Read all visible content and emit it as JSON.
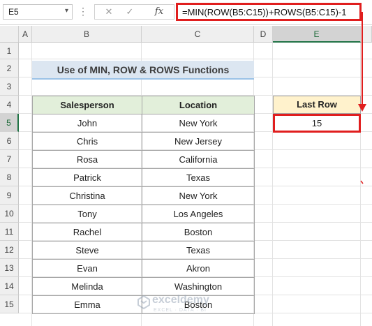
{
  "name_box": {
    "value": "E5",
    "icon": "chevron-down-icon"
  },
  "formula_bar": {
    "options_icon": "vertical-dots-icon",
    "cancel_glyph": "✕",
    "enter_glyph": "✓",
    "fx_label": "fx",
    "formula": "=MIN(ROW(B5:C15))+ROWS(B5:C15)-1"
  },
  "columns": [
    "A",
    "B",
    "C",
    "D",
    "E"
  ],
  "selected_column": "E",
  "rows": [
    "1",
    "2",
    "3",
    "4",
    "5",
    "6",
    "7",
    "8",
    "9",
    "10",
    "11",
    "12",
    "13",
    "14",
    "15"
  ],
  "selected_row": "5",
  "title": "Use of MIN, ROW & ROWS Functions",
  "table": {
    "headers": [
      "Salesperson",
      "Location"
    ],
    "rows": [
      [
        "John",
        "New York"
      ],
      [
        "Chris",
        "New Jersey"
      ],
      [
        "Rosa",
        "California"
      ],
      [
        "Patrick",
        "Texas"
      ],
      [
        "Christina",
        "New York"
      ],
      [
        "Tony",
        "Los Angeles"
      ],
      [
        "Rachel",
        "Boston"
      ],
      [
        "Steve",
        "Texas"
      ],
      [
        "Evan",
        "Akron"
      ],
      [
        "Melinda",
        "Washington"
      ],
      [
        "Emma",
        "Boston"
      ]
    ]
  },
  "last_row": {
    "header": "Last Row",
    "value": "15"
  },
  "watermark": {
    "name": "exceldemy",
    "tagline": "EXCEL · DATA · BI"
  },
  "colors": {
    "annotation_red": "#e01e1e",
    "title_fill": "#dce6f1",
    "header_fill": "#e2efda",
    "last_row_fill": "#fff2cc",
    "excel_green": "#217346"
  }
}
